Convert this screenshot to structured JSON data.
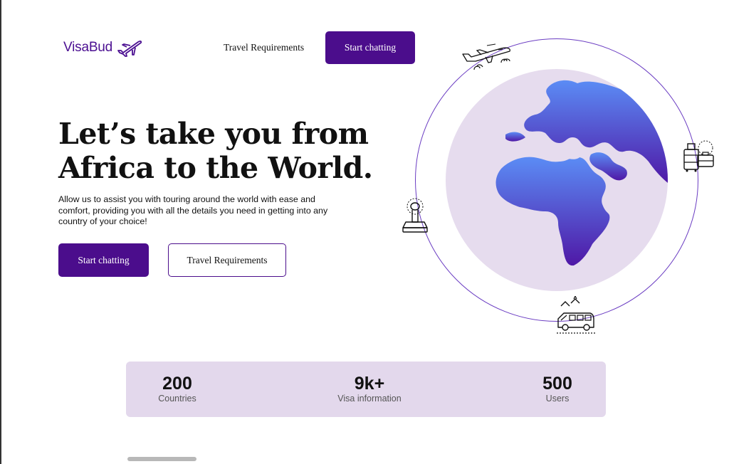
{
  "header": {
    "logo_text": "VisaBud",
    "nav_link": "Travel Requirements",
    "cta_label": "Start chatting"
  },
  "hero": {
    "title_line1": "Let’s take you from",
    "title_line2": "Africa to the World.",
    "subtitle": "Allow us to assist you with touring around the world with ease and comfort, providing you with all the details you need in getting into any country of your choice!",
    "primary_button": "Start chatting",
    "secondary_button": "Travel Requirements"
  },
  "illustration": {
    "icons": [
      "airplane-icon",
      "luggage-icon",
      "stamp-icon",
      "van-icon"
    ]
  },
  "stats": [
    {
      "value": "200",
      "label": "Countries"
    },
    {
      "value": "9k+",
      "label": "Visa information"
    },
    {
      "value": "500",
      "label": "Users"
    }
  ],
  "colors": {
    "brand_purple": "#4b0d8c",
    "stats_bg": "#e3d8ec",
    "globe_bg": "#e6dcee",
    "map_gradient_top": "#5b8cf5",
    "map_gradient_bottom": "#4f18a6"
  }
}
